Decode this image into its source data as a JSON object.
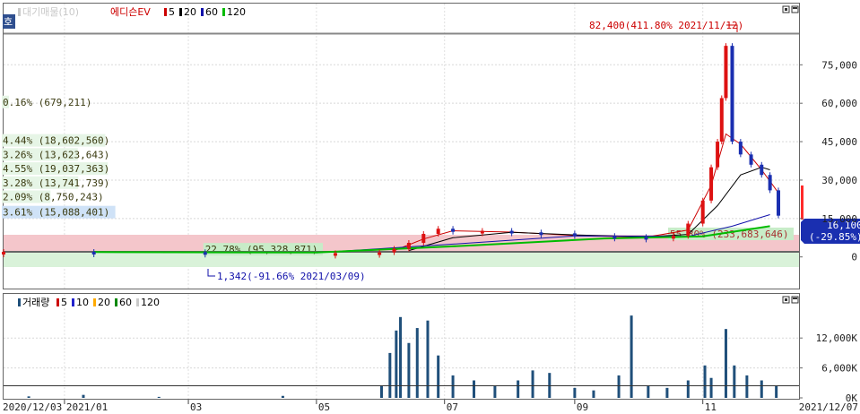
{
  "price_legend": [
    {
      "text": "대기매물(10)",
      "color": "#c9c9c9",
      "box": "#c9c9c9"
    },
    {
      "text": "에디슨EV",
      "color": "#cc0000",
      "box": "#ffffff"
    },
    {
      "text": "5",
      "color": "#000000",
      "box": "#cc0000"
    },
    {
      "text": "20",
      "color": "#000000",
      "box": "#000000"
    },
    {
      "text": "60",
      "color": "#000000",
      "box": "#1111aa"
    },
    {
      "text": "120",
      "color": "#000000",
      "box": "#00bb00"
    }
  ],
  "volume_legend": [
    {
      "text": "거래량",
      "color": "#000000",
      "box": "#1f4f7a"
    },
    {
      "text": "5",
      "color": "#000000",
      "box": "#cc0000"
    },
    {
      "text": "10",
      "color": "#000000",
      "box": "#2222cc"
    },
    {
      "text": "20",
      "color": "#000000",
      "box": "#ffaa00"
    },
    {
      "text": "60",
      "color": "#000000",
      "box": "#008800"
    },
    {
      "text": "120",
      "color": "#000000",
      "box": "#c9c9c9"
    }
  ],
  "left_badge": "호",
  "max_label": "82,400(411.80% 2021/11/12)",
  "min_label": "1,342(-91.66% 2021/03/09)",
  "current_price": "16,100",
  "current_change": "(-29.85%)",
  "chart_data": {
    "type": "candlestick",
    "price_axis": {
      "ticks": [
        0,
        15000,
        30000,
        45000,
        60000,
        75000
      ],
      "tick_labels": [
        "0",
        "15,000",
        "30,000",
        "45,000",
        "60,000",
        "75,000"
      ],
      "range": [
        -5000,
        87000
      ]
    },
    "volume_axis": {
      "tick_labels": [
        "0K",
        "6,000K",
        "12,000K"
      ],
      "ticks": [
        0,
        6000,
        12000
      ],
      "range": [
        0,
        18500
      ]
    },
    "x_labels": [
      "2020/12/03",
      "2021/01",
      "03",
      "05",
      "07",
      "09",
      "11",
      "2021/12/07"
    ],
    "x_label_dates": [
      "2020-12-03",
      "2021-01-01",
      "2021-03-01",
      "2021-05-01",
      "2021-07-01",
      "2021-09-01",
      "2021-11-01",
      "2021-12-07"
    ],
    "grid": true,
    "volume_profile": [
      {
        "label": "0.16% (679,211)",
        "price": 60500,
        "share": 0.16
      },
      {
        "label": "4.44% (18,602,560)",
        "price": 45500,
        "share": 4.44
      },
      {
        "label": "3.26% (13,623,643)",
        "price": 40000,
        "share": 3.26
      },
      {
        "label": "4.55% (19,037,363)",
        "price": 34500,
        "share": 4.55
      },
      {
        "label": "3.28% (13,741,739)",
        "price": 29000,
        "share": 3.28
      },
      {
        "label": "2.09% (8,750,243)",
        "price": 23500,
        "share": 2.09
      },
      {
        "label": "3.61% (15,088,401)",
        "price": 17500,
        "share": 3.61
      },
      {
        "label": "55.80% (233,683,646)",
        "price": 9000,
        "share": 55.8
      },
      {
        "label": "22.78% (95,328,871)",
        "price": 3000,
        "share": 22.78
      }
    ],
    "series": [
      {
        "name": "에디슨EV",
        "kind": "candle",
        "points": [
          [
            "2020-12-03",
            2000
          ],
          [
            "2021-01-15",
            1900
          ],
          [
            "2021-03-09",
            1342
          ],
          [
            "2021-05-10",
            1500
          ],
          [
            "2021-05-31",
            1800
          ],
          [
            "2021-06-07",
            3200
          ],
          [
            "2021-06-14",
            5500
          ],
          [
            "2021-06-21",
            9000
          ],
          [
            "2021-06-28",
            11000
          ],
          [
            "2021-07-05",
            9800
          ],
          [
            "2021-07-19",
            10200
          ],
          [
            "2021-08-02",
            9600
          ],
          [
            "2021-08-16",
            9200
          ],
          [
            "2021-09-01",
            8200
          ],
          [
            "2021-09-20",
            7800
          ],
          [
            "2021-10-05",
            7600
          ],
          [
            "2021-10-18",
            8200
          ],
          [
            "2021-10-25",
            13000
          ],
          [
            "2021-11-01",
            22000
          ],
          [
            "2021-11-05",
            35000
          ],
          [
            "2021-11-08",
            45000
          ],
          [
            "2021-11-10",
            62000
          ],
          [
            "2021-11-12",
            82400
          ],
          [
            "2021-11-15",
            45000
          ],
          [
            "2021-11-19",
            40000
          ],
          [
            "2021-11-24",
            36000
          ],
          [
            "2021-11-29",
            32000
          ],
          [
            "2021-12-03",
            26000
          ],
          [
            "2021-12-07",
            16100
          ]
        ]
      },
      {
        "name": "5",
        "kind": "ma",
        "color": "#cc0000",
        "points": [
          [
            "2021-06-07",
            2500
          ],
          [
            "2021-06-21",
            7000
          ],
          [
            "2021-07-05",
            10200
          ],
          [
            "2021-08-02",
            9700
          ],
          [
            "2021-09-01",
            8400
          ],
          [
            "2021-10-05",
            7700
          ],
          [
            "2021-10-25",
            10500
          ],
          [
            "2021-11-05",
            28000
          ],
          [
            "2021-11-12",
            48000
          ],
          [
            "2021-11-19",
            44000
          ],
          [
            "2021-11-29",
            34000
          ],
          [
            "2021-12-07",
            25000
          ]
        ]
      },
      {
        "name": "20",
        "kind": "ma",
        "color": "#000000",
        "points": [
          [
            "2021-06-14",
            2500
          ],
          [
            "2021-07-05",
            7500
          ],
          [
            "2021-08-02",
            9600
          ],
          [
            "2021-09-01",
            8600
          ],
          [
            "2021-10-05",
            7800
          ],
          [
            "2021-10-25",
            8800
          ],
          [
            "2021-11-08",
            20000
          ],
          [
            "2021-11-19",
            32000
          ],
          [
            "2021-11-29",
            35000
          ],
          [
            "2021-12-03",
            34000
          ]
        ]
      },
      {
        "name": "60",
        "kind": "ma",
        "color": "#1111aa",
        "points": [
          [
            "2021-05-01",
            1600
          ],
          [
            "2021-07-05",
            5000
          ],
          [
            "2021-09-01",
            8200
          ],
          [
            "2021-10-25",
            8000
          ],
          [
            "2021-11-15",
            12000
          ],
          [
            "2021-12-03",
            16500
          ]
        ]
      },
      {
        "name": "120",
        "kind": "ma",
        "color": "#00bb00",
        "points": [
          [
            "2021-01-15",
            1900
          ],
          [
            "2021-05-01",
            1700
          ],
          [
            "2021-07-15",
            4500
          ],
          [
            "2021-09-15",
            7200
          ],
          [
            "2021-11-01",
            8000
          ],
          [
            "2021-12-03",
            12000
          ]
        ]
      }
    ],
    "volume": [
      [
        "2020-12-15",
        300
      ],
      [
        "2021-01-10",
        600
      ],
      [
        "2021-02-15",
        200
      ],
      [
        "2021-04-15",
        400
      ],
      [
        "2021-06-01",
        2500
      ],
      [
        "2021-06-05",
        9000
      ],
      [
        "2021-06-08",
        13500
      ],
      [
        "2021-06-10",
        16200
      ],
      [
        "2021-06-14",
        11000
      ],
      [
        "2021-06-18",
        14000
      ],
      [
        "2021-06-23",
        15500
      ],
      [
        "2021-06-28",
        8500
      ],
      [
        "2021-07-05",
        4500
      ],
      [
        "2021-07-15",
        3500
      ],
      [
        "2021-07-25",
        2500
      ],
      [
        "2021-08-05",
        3500
      ],
      [
        "2021-08-12",
        5500
      ],
      [
        "2021-08-20",
        5000
      ],
      [
        "2021-09-01",
        2000
      ],
      [
        "2021-09-10",
        1500
      ],
      [
        "2021-09-22",
        4500
      ],
      [
        "2021-09-28",
        16500
      ],
      [
        "2021-10-06",
        2500
      ],
      [
        "2021-10-15",
        2000
      ],
      [
        "2021-10-25",
        3500
      ],
      [
        "2021-11-02",
        6500
      ],
      [
        "2021-11-05",
        4000
      ],
      [
        "2021-11-12",
        13800
      ],
      [
        "2021-11-16",
        6500
      ],
      [
        "2021-11-22",
        4500
      ],
      [
        "2021-11-29",
        3500
      ],
      [
        "2021-12-06",
        2500
      ]
    ]
  }
}
